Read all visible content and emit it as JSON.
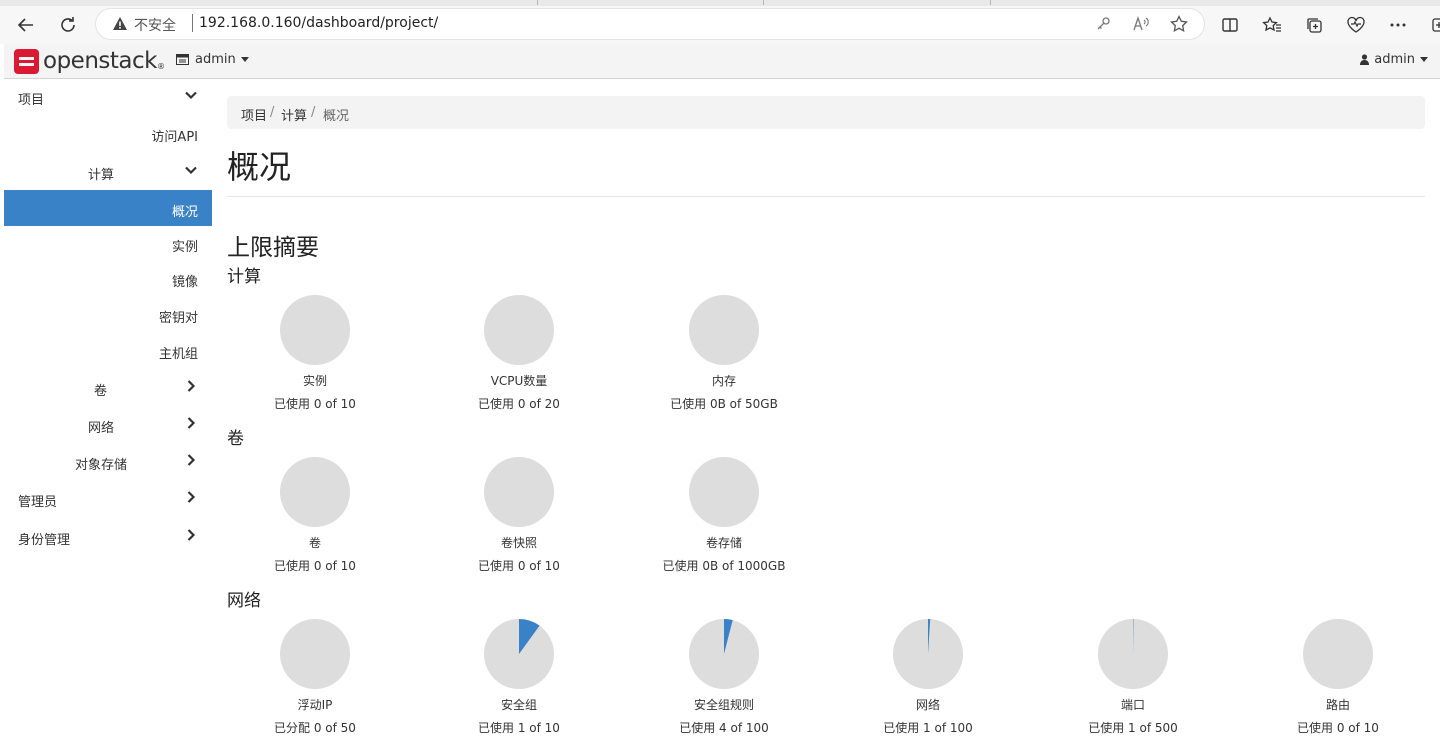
{
  "browser": {
    "insecure_label": "不安全",
    "url": "192.168.0.160/dashboard/project/"
  },
  "topbar": {
    "logo_text": "openstack",
    "project_menu": "admin",
    "user_menu": "admin"
  },
  "sidebar": {
    "items": [
      {
        "label": "项目",
        "chevron": "down"
      },
      {
        "label": "访问API"
      },
      {
        "label": "计算",
        "chevron": "down"
      },
      {
        "label": "概况",
        "active": true
      },
      {
        "label": "实例"
      },
      {
        "label": "镜像"
      },
      {
        "label": "密钥对"
      },
      {
        "label": "主机组"
      },
      {
        "label": "卷",
        "chevron": "right"
      },
      {
        "label": "网络",
        "chevron": "right"
      },
      {
        "label": "对象存储",
        "chevron": "right"
      },
      {
        "label": "管理员",
        "chevron": "right"
      },
      {
        "label": "身份管理",
        "chevron": "right"
      }
    ]
  },
  "breadcrumb": [
    "项目",
    "计算",
    "概况"
  ],
  "page": {
    "title": "概况",
    "section_title": "上限摘要"
  },
  "groups": [
    {
      "title": "计算",
      "charts": [
        {
          "name": "实例",
          "usage": "已使用 0 of 10",
          "used": 0,
          "total": 10
        },
        {
          "name": "VCPU数量",
          "usage": "已使用 0 of 20",
          "used": 0,
          "total": 20
        },
        {
          "name": "内存",
          "usage": "已使用 0B of 50GB",
          "used": 0,
          "total": 50
        }
      ]
    },
    {
      "title": "卷",
      "charts": [
        {
          "name": "卷",
          "usage": "已使用 0 of 10",
          "used": 0,
          "total": 10
        },
        {
          "name": "卷快照",
          "usage": "已使用 0 of 10",
          "used": 0,
          "total": 10
        },
        {
          "name": "卷存储",
          "usage": "已使用 0B of 1000GB",
          "used": 0,
          "total": 1000
        }
      ]
    },
    {
      "title": "网络",
      "charts": [
        {
          "name": "浮动IP",
          "usage": "已分配 0 of 50",
          "used": 0,
          "total": 50
        },
        {
          "name": "安全组",
          "usage": "已使用 1 of 10",
          "used": 1,
          "total": 10
        },
        {
          "name": "安全组规则",
          "usage": "已使用 4 of 100",
          "used": 4,
          "total": 100
        },
        {
          "name": "网络",
          "usage": "已使用 1 of 100",
          "used": 1,
          "total": 100
        },
        {
          "name": "端口",
          "usage": "已使用 1 of 500",
          "used": 1,
          "total": 500
        },
        {
          "name": "路由",
          "usage": "已使用 0 of 10",
          "used": 0,
          "total": 10
        }
      ]
    }
  ],
  "colors": {
    "accent": "#3a82c8",
    "pie_empty": "#dddddd",
    "brand_red": "#da1a32"
  }
}
